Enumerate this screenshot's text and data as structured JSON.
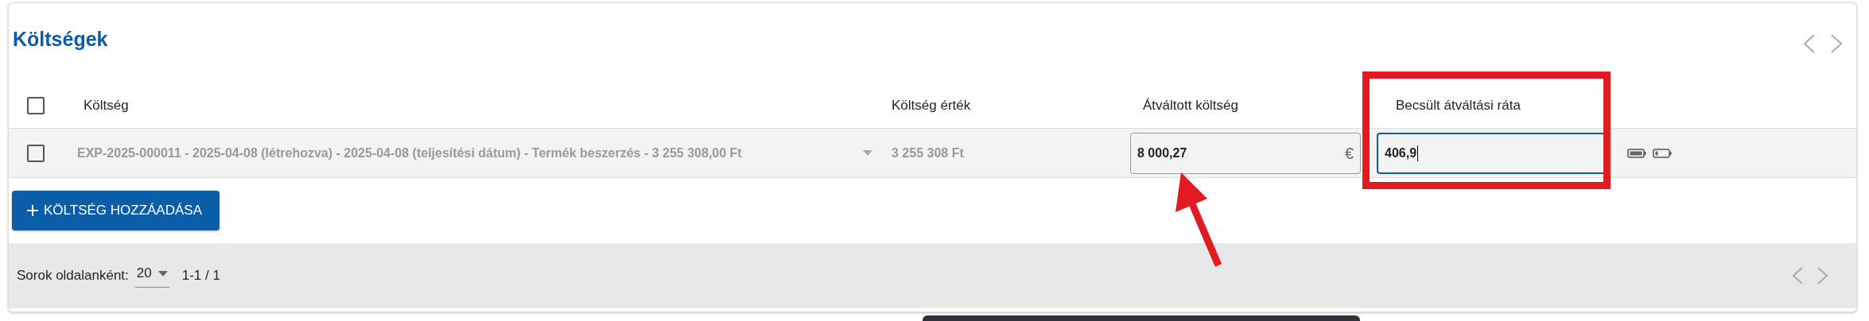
{
  "title": "Költségek",
  "table": {
    "header_checked": false,
    "columns": [
      "Költség",
      "Költség érték",
      "Átváltott költség",
      "Becsült átváltási ráta"
    ],
    "rows": [
      {
        "checked": false,
        "cost": "EXP-2025-000011 - 2025-04-08 (létrehozva) - 2025-04-08 (teljesítési dátum) - Termék beszerzés - 3 255 308,00 Ft",
        "value": "3 255 308 Ft",
        "converted": "8 000,27",
        "currency": "€",
        "rate": "406,9",
        "rate_focused": true
      }
    ]
  },
  "add_button": "KÖLTSÉG HOZZÁADÁSA",
  "footer": {
    "rows_per_page_label": "Sorok oldalanként:",
    "rows_per_page": "20",
    "range": "1-1 / 1"
  }
}
